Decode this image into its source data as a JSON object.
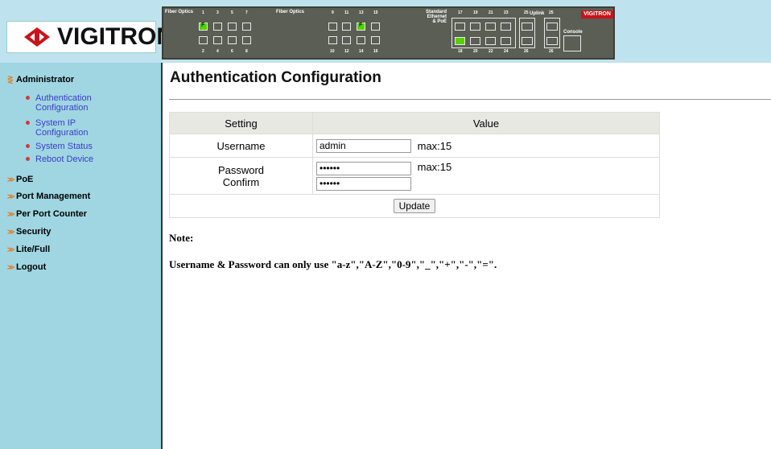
{
  "brand": {
    "name": "VIGITRON",
    "small": "VIGITRON",
    "accent": "#c8141c"
  },
  "panel": {
    "fiber_label_1": "Fiber Optics",
    "fiber_label_2": "Fiber Optics",
    "standard_label_1": "Standard",
    "standard_label_2": "Ethernet",
    "standard_label_3": "& PoE",
    "uplink_label": "Uplink",
    "console_label": "Console",
    "top_nums_a": [
      "1",
      "3",
      "5",
      "7"
    ],
    "bot_nums_a": [
      "2",
      "4",
      "6",
      "8"
    ],
    "top_nums_b": [
      "9",
      "11",
      "13",
      "15"
    ],
    "bot_nums_b": [
      "10",
      "12",
      "14",
      "16"
    ],
    "top_nums_c": [
      "17",
      "19",
      "21",
      "23"
    ],
    "bot_nums_c": [
      "18",
      "20",
      "22",
      "24"
    ],
    "top_nums_d": [
      "25",
      "25"
    ],
    "bot_nums_d": [
      "26",
      "26"
    ],
    "port_letter": "F"
  },
  "sidebar": {
    "administrator": "Administrator",
    "sub_items": [
      {
        "line1": "Authentication",
        "line2": "Configuration"
      },
      {
        "line1": "System IP",
        "line2": "Configuration"
      },
      {
        "line1": "System Status",
        "line2": ""
      },
      {
        "line1": "Reboot Device",
        "line2": ""
      }
    ],
    "items": [
      "PoE",
      "Port Management",
      "Per Port Counter",
      "Security",
      "Lite/Full",
      "Logout"
    ]
  },
  "main": {
    "title": "Authentication Configuration",
    "table": {
      "col_setting": "Setting",
      "col_value": "Value",
      "username_label": "Username",
      "username_value": "admin",
      "username_max": "max:15",
      "password_label": "Password",
      "confirm_label": "Confirm",
      "password_value": "••••••",
      "confirm_value": "••••••",
      "password_max": "max:15",
      "update_label": "Update"
    },
    "note_title": "Note:",
    "note_text": "Username & Password can only use \"a-z\",\"A-Z\",\"0-9\",\"_\",\"+\",\"-\",\"=\"."
  }
}
